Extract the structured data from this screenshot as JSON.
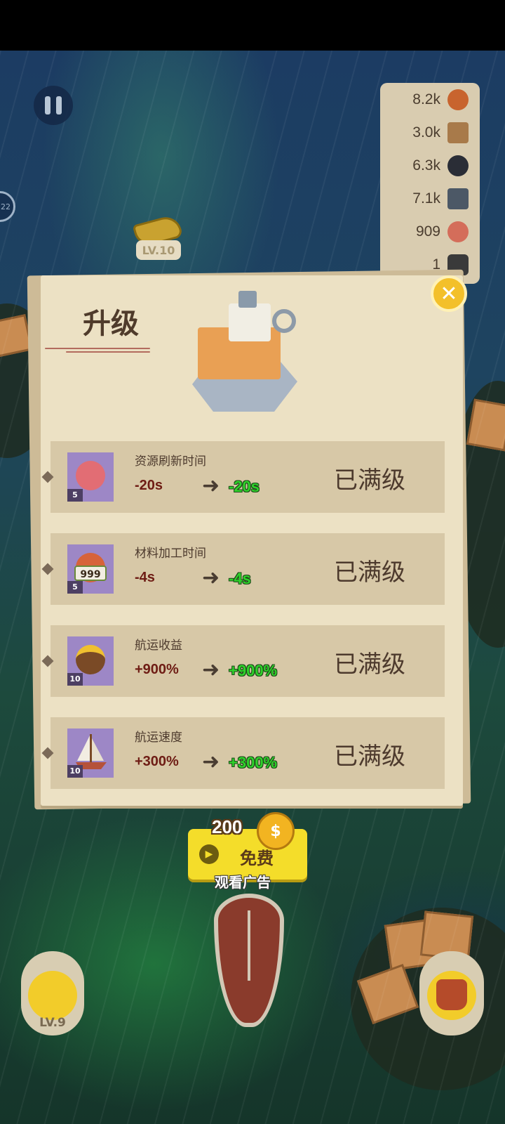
{
  "hud": {
    "ship_level": "LV.10",
    "side_indicator": "22",
    "resources": [
      {
        "value": "8.2k",
        "icon": "wood-log-icon",
        "color": "#c8642e"
      },
      {
        "value": "3.0k",
        "icon": "stone-block-icon",
        "color": "#a87a4a"
      },
      {
        "value": "6.3k",
        "icon": "bomb-icon",
        "color": "#2a2d36"
      },
      {
        "value": "7.1k",
        "icon": "iron-ingot-icon",
        "color": "#4c5866"
      },
      {
        "value": "909",
        "icon": "meat-icon",
        "color": "#d46d5a"
      },
      {
        "value": "1",
        "icon": "coal-icon",
        "color": "#3a3a3a"
      }
    ]
  },
  "dialog": {
    "title": "升级",
    "close_symbol": "✕",
    "rows": [
      {
        "name": "资源刷新时间",
        "level": "5",
        "current": "-20s",
        "arrow": "➜",
        "next": "-20s",
        "status": "已满级",
        "icon": "coral-refresh-icon",
        "icon_color": "#e26d74"
      },
      {
        "name": "材料加工时间",
        "level": "5",
        "current": "-4s",
        "arrow": "➜",
        "next": "-4s",
        "status": "已满级",
        "icon": "material-999-icon",
        "icon_label": "999",
        "icon_color": "#d7633a"
      },
      {
        "name": "航运收益",
        "level": "10",
        "current": "+900%",
        "arrow": "➜",
        "next": "+900%",
        "status": "已满级",
        "icon": "gold-sack-icon",
        "icon_color": "#7a4a26"
      },
      {
        "name": "航运速度",
        "level": "10",
        "current": "+300%",
        "arrow": "➜",
        "next": "+300%",
        "status": "已满级",
        "icon": "sailboat-icon",
        "icon_color": "#f2ede2"
      }
    ]
  },
  "ad": {
    "amount": "200",
    "coin_symbol": "$",
    "label": "免费",
    "sub_label": "观看广告"
  },
  "bottom": {
    "ship_level_label": "LV.9"
  }
}
